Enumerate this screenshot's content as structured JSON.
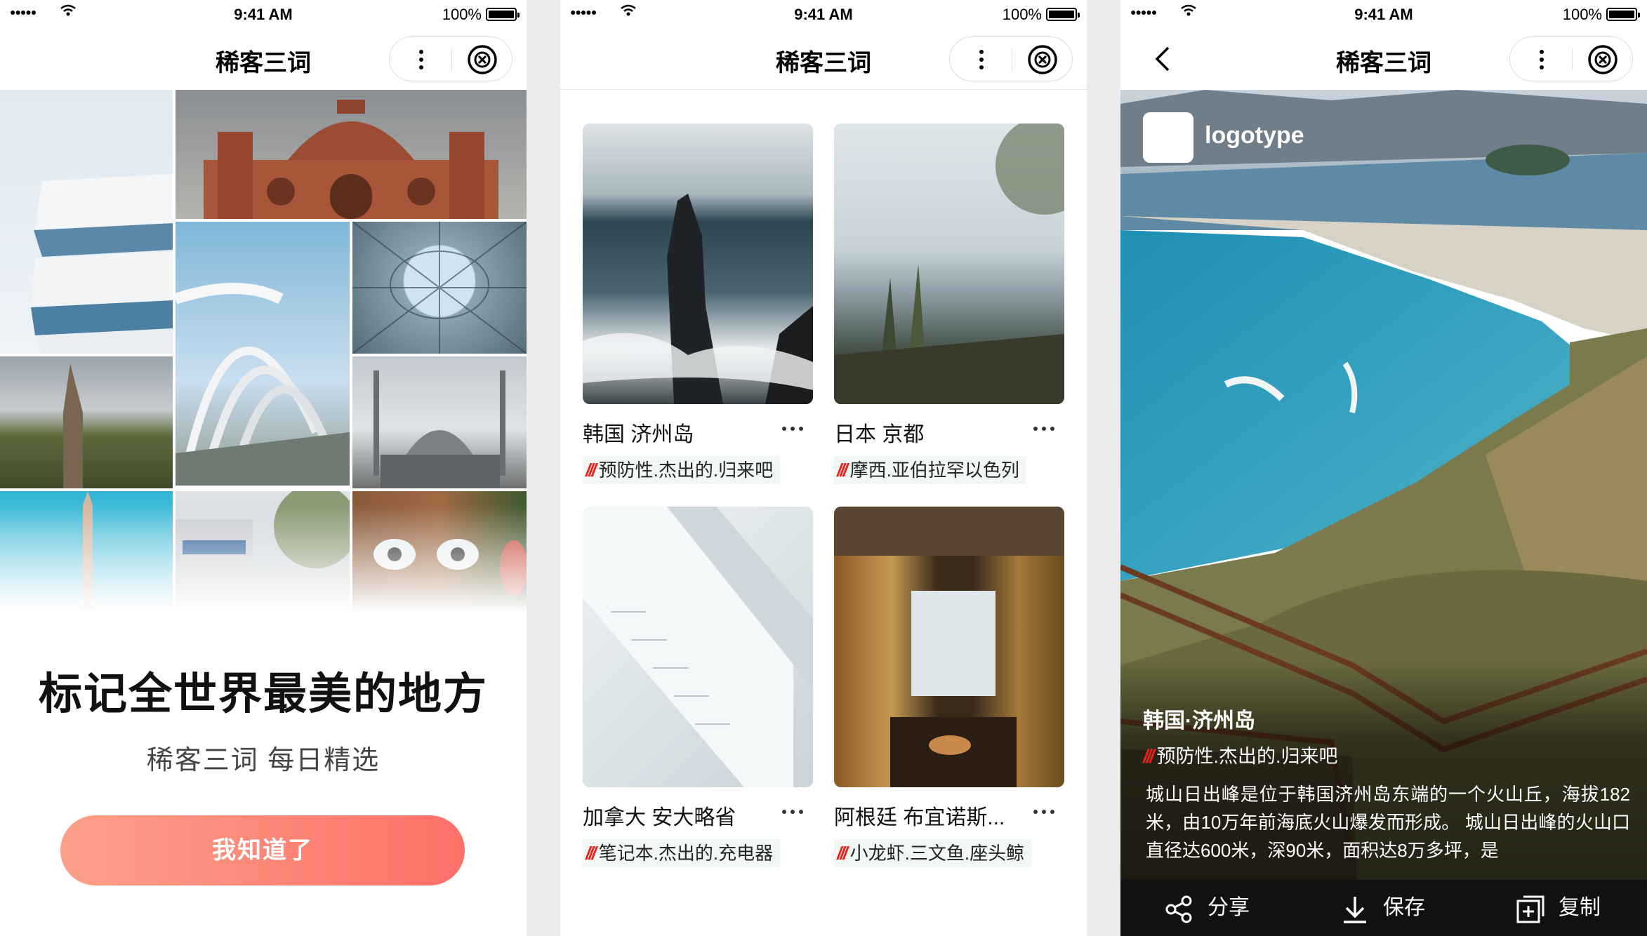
{
  "status": {
    "time": "9:41 AM",
    "battery": "100%"
  },
  "app": {
    "title": "稀客三词"
  },
  "screen1": {
    "headline": "标记全世界最美的地方",
    "subline": "稀客三词 每日精选",
    "cta": "我知道了"
  },
  "screen2": {
    "cards": [
      {
        "name": "韩国 济州岛",
        "tag": "预防性.杰出的.归来吧"
      },
      {
        "name": "日本 京都",
        "tag": "摩西.亚伯拉罕以色列"
      },
      {
        "name": "加拿大 安大略省",
        "tag": "笔记本.杰出的.充电器"
      },
      {
        "name": "阿根廷 布宜诺斯...",
        "tag": "小龙虾.三文鱼.座头鲸"
      }
    ],
    "slash": "///"
  },
  "screen3": {
    "logo": "logotype",
    "place": "韩国·济州岛",
    "tag": "预防性.杰出的.归来吧",
    "description": "城山日出峰是位于韩国济州岛东端的一个火山丘，海拔182米，由10万年前海底火山爆发而形成。 城山日出峰的火山口直径达600米，深90米，面积达8万多坪，是",
    "actions": {
      "share": "分享",
      "save": "保存",
      "copy": "复制"
    }
  },
  "colors": {
    "accent_start": "#fca089",
    "accent_end": "#fd7068",
    "slash_red": "#e8221f",
    "tag_bg": "#f1f7f3"
  },
  "icons": [
    "wifi-icon",
    "battery-icon",
    "more-icon",
    "close-circle-icon",
    "back-chevron-icon",
    "share-icon",
    "download-icon",
    "copy-icon"
  ]
}
